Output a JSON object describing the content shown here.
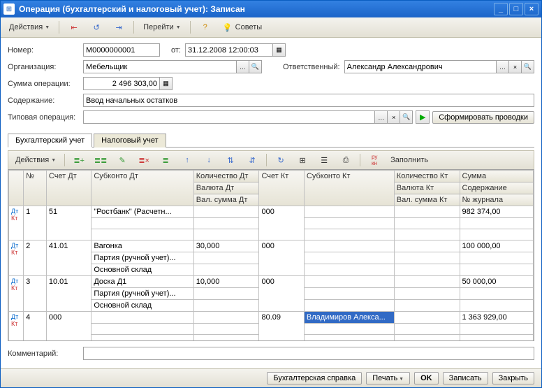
{
  "window": {
    "title": "Операция (бухгалтерский и налоговый учет): Записан"
  },
  "toolbar": {
    "actions": "Действия",
    "goto": "Перейти",
    "tips": "Советы"
  },
  "form": {
    "number_label": "Номер:",
    "number": "М0000000001",
    "from_label": "от:",
    "date": "31.12.2008 12:00:03",
    "org_label": "Организация:",
    "org": "Мебельщик",
    "resp_label": "Ответственный:",
    "resp": "Александр Александрович",
    "sum_label": "Сумма операции:",
    "sum": "2 496 303,00",
    "content_label": "Содержание:",
    "content": "Ввод начальных остатков",
    "typeop_label": "Типовая операция:",
    "typeop": "",
    "form_entries": "Сформировать проводки"
  },
  "tabs": {
    "t1": "Бухгалтерский учет",
    "t2": "Налоговый учет"
  },
  "gridtb": {
    "actions": "Действия",
    "fill": "Заполнить"
  },
  "headers": {
    "n": "№",
    "acc_dt": "Счет Дт",
    "sub_dt": "Субконто Дт",
    "qty_dt": "Количество Дт",
    "acc_kt": "Счет Кт",
    "sub_kt": "Субконто Кт",
    "qty_kt": "Количество Кт",
    "sum": "Сумма",
    "cur_dt": "Валюта Дт",
    "cur_kt": "Валюта Кт",
    "content": "Содержание",
    "vsum_dt": "Вал. сумма Дт",
    "vsum_kt": "Вал. сумма Кт",
    "journal": "№ журнала"
  },
  "rows": [
    {
      "n": "1",
      "acc_dt": "51",
      "sub_dt": [
        "\"Ростбанк\" (Расчетн...",
        "",
        ""
      ],
      "qty_dt": "",
      "acc_kt": "000",
      "sub_kt": [
        "",
        "",
        ""
      ],
      "qty_kt": "",
      "sum": "982 374,00"
    },
    {
      "n": "2",
      "acc_dt": "41.01",
      "sub_dt": [
        "Вагонка",
        "Партия (ручной учет)...",
        "Основной склад"
      ],
      "qty_dt": "30,000",
      "acc_kt": "000",
      "sub_kt": [
        "",
        "",
        ""
      ],
      "qty_kt": "",
      "sum": "100 000,00"
    },
    {
      "n": "3",
      "acc_dt": "10.01",
      "sub_dt": [
        "Доска Д1",
        "Партия (ручной учет)...",
        "Основной склад"
      ],
      "qty_dt": "10,000",
      "acc_kt": "000",
      "sub_kt": [
        "",
        "",
        ""
      ],
      "qty_kt": "",
      "sum": "50 000,00"
    },
    {
      "n": "4",
      "acc_dt": "000",
      "sub_dt": [
        "",
        "",
        ""
      ],
      "qty_dt": "",
      "acc_kt": "80.09",
      "sub_kt": [
        "Владимиров Алекса...",
        "",
        ""
      ],
      "qty_kt": "",
      "sum": "1 363 929,00",
      "selected": true
    }
  ],
  "footer": {
    "comment_label": "Комментарий:",
    "comment": ""
  },
  "btns": {
    "ref": "Бухгалтерская справка",
    "print": "Печать",
    "ok": "OK",
    "save": "Записать",
    "close": "Закрыть"
  }
}
